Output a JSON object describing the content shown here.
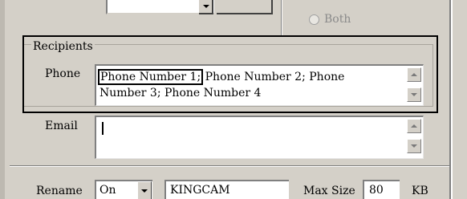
{
  "schedule": {
    "radio_both_label": "Both"
  },
  "recipients": {
    "group_label": "Recipients",
    "phone": {
      "label": "Phone",
      "selected_entry": "Phone Number 1;",
      "rest_line1": " Phone Number 2; Phone",
      "line2": "Number 3; Phone Number 4"
    }
  },
  "email": {
    "label": "Email",
    "value": ""
  },
  "bottom": {
    "rename_label": "Rename",
    "rename_value": "On",
    "name_value": "KINGCAM",
    "maxsize_label": "Max Size",
    "maxsize_value": "80",
    "unit_label": "KB"
  }
}
